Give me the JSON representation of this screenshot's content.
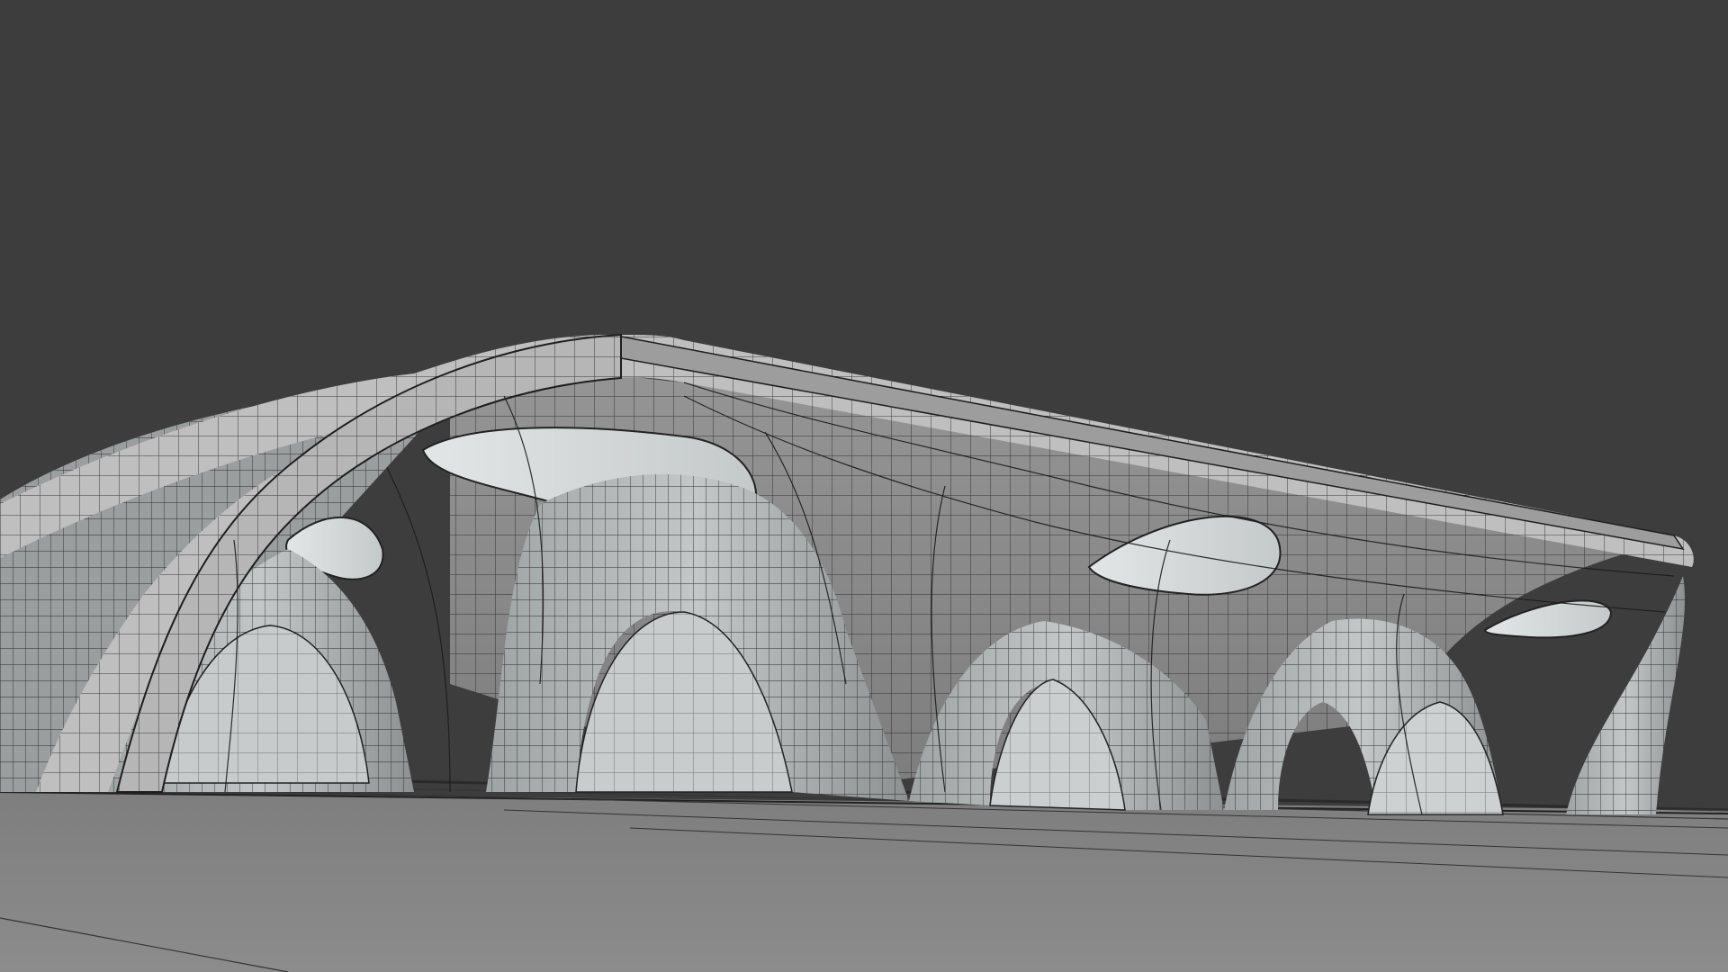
{
  "scene": {
    "subject": "wireframe-shaded-3d-canopy",
    "colors": {
      "background": "#3d3d3d",
      "ground": "#8a8a8a",
      "ground_far": "#777777",
      "roof_rim": "#bdbdbd",
      "roof_underside": "#8c8c8c",
      "pillar_light": "#b8bcbc",
      "pillar_dark": "#7b7f80",
      "skylight": "#d6dada",
      "arch_interior": "#c9cdcd",
      "wire": "#1e1e1e"
    },
    "parts": [
      "ground-plane",
      "roof-slab",
      "roof-rim",
      "skylight-openings",
      "arched-pillars",
      "mesh-wireframe"
    ]
  }
}
